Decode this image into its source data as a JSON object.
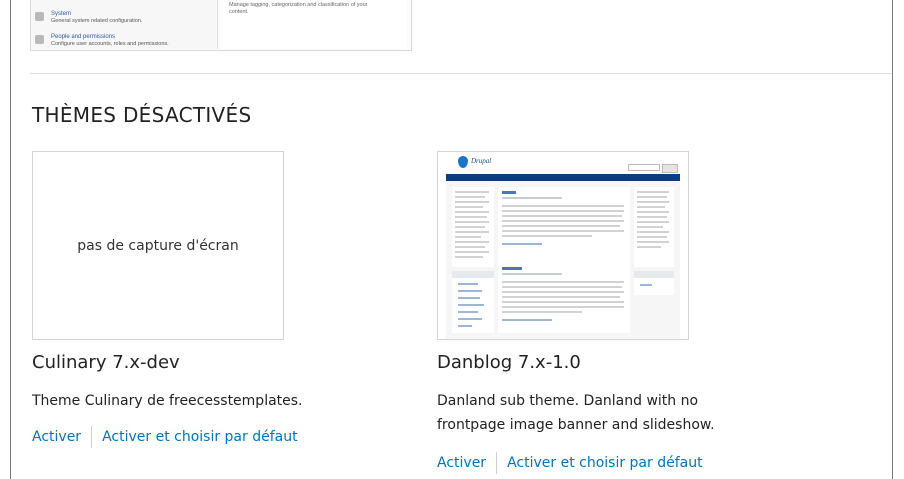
{
  "top_panel": {
    "items": [
      {
        "title": "System",
        "desc": "General system related configuration."
      },
      {
        "title": "People and permissions",
        "desc": "Configure user accounts, roles and permissions."
      }
    ],
    "right_text_1": "Manage tagging, categorization and classification of your",
    "right_text_2": "content."
  },
  "section": {
    "title": "THÈMES DÉSACTIVÉS"
  },
  "themes": [
    {
      "noscreenshot": "pas de capture d'écran",
      "name": "Culinary 7.x-dev",
      "description": "Theme Culinary de freecesstemplates.",
      "actions": [
        "Activer",
        "Activer et choisir par défaut"
      ]
    },
    {
      "name": "Danblog 7.x-1.0",
      "description_line1": "Danland sub theme. Danland with no",
      "description_line2": "frontpage image banner and slideshow.",
      "actions": [
        "Activer",
        "Activer et choisir par défaut"
      ],
      "screenshot": {
        "logo_text": "Drupal",
        "post_title_1": "Story",
        "post_title_2": "Blog entry",
        "sidebar_title": "Drupal",
        "welcome_title": "Welcome"
      }
    }
  ],
  "colors": {
    "link": "#0074bd",
    "nav": "#0b3f7c"
  }
}
